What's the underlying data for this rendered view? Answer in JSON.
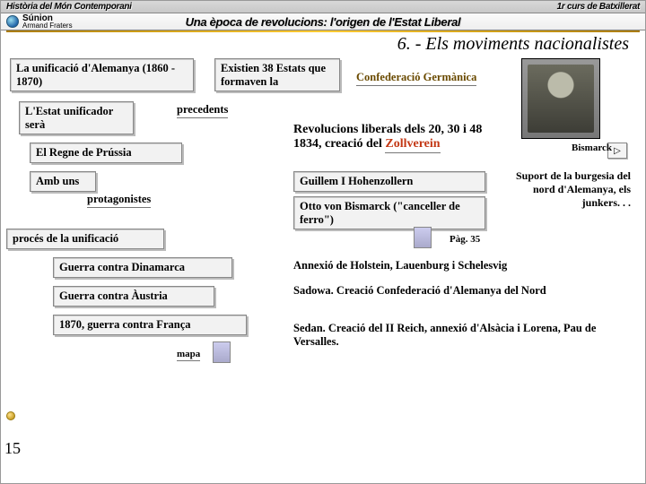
{
  "topbar": {
    "left": "Història del Món Contemporani",
    "right": "1r curs de Batxillerat"
  },
  "logo": {
    "brand": "Súnion",
    "sub": "Armand Fraters"
  },
  "unitTitle": "Una època de revolucions: l'origen de l'Estat Liberal",
  "sectionTitle": "6. - Els moviments nacionalistes",
  "boxes": {
    "title": "La unificació d'Alemanya (1860 - 1870)",
    "unificador": "L'Estat unificador serà",
    "prussia": "El Regne de Prússia",
    "ambuns": "Amb uns",
    "proces": "procés de la unificació",
    "dinamarca": "Guerra contra Dinamarca",
    "austria": "Guerra contra Àustria",
    "franca": "1870, guerra contra França",
    "existien": "Existien 38 Estats que formaven la",
    "guillem": "Guillem I Hohenzollern",
    "bismarck_ferro": "Otto von Bismarck (\"canceller de ferro\")"
  },
  "labels": {
    "precedents": "precedents",
    "protagonistes": "protagonistes",
    "confed": "Confederació Germànica",
    "bismarck": "Bismarck",
    "revolucions": "Revolucions liberals dels 20, 30 i 48",
    "zollverein_line": "1834, creació del ",
    "zollverein": "Zollverein",
    "suport": "Suport de la burgesia del nord d'Alemanya, els junkers. . .",
    "pag": "Pàg. 35",
    "mapa": "mapa",
    "holstein": "Annexió de Holstein, Lauenburg i Schelesvig",
    "sadowa": "Sadowa. Creació Confederació d'Alemanya del Nord",
    "sedan": "Sedan. Creació del II Reich, annexió d'Alsàcia i Lorena, Pau de Versalles."
  },
  "pageNum": "15"
}
